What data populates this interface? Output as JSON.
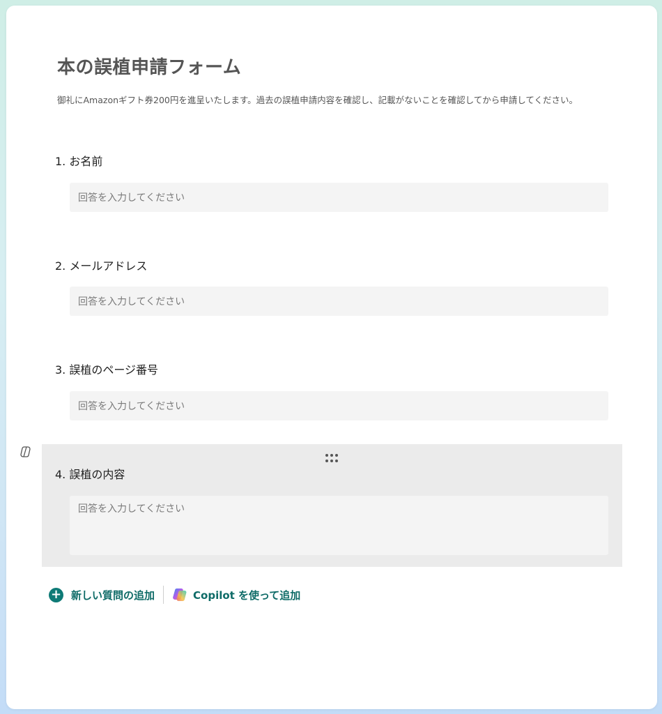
{
  "form": {
    "title": "本の誤植申請フォーム",
    "description": "御礼にAmazonギフト券200円を進呈いたします。過去の誤植申請内容を確認し、記載がないことを確認してから申請してください。"
  },
  "questions": [
    {
      "label": "1. お名前",
      "placeholder": "回答を入力してください"
    },
    {
      "label": "2. メールアドレス",
      "placeholder": "回答を入力してください"
    },
    {
      "label": "3. 誤植のページ番号",
      "placeholder": "回答を入力してください"
    },
    {
      "label": "4. 誤植の内容",
      "placeholder": "回答を入力してください"
    }
  ],
  "actions": {
    "add_question": "新しい質問の追加",
    "copilot_add": "Copilot を使って追加"
  },
  "colors": {
    "accent": "#0e7a76",
    "active_question_bg": "#ebebeb",
    "input_bg": "#f4f4f4"
  }
}
